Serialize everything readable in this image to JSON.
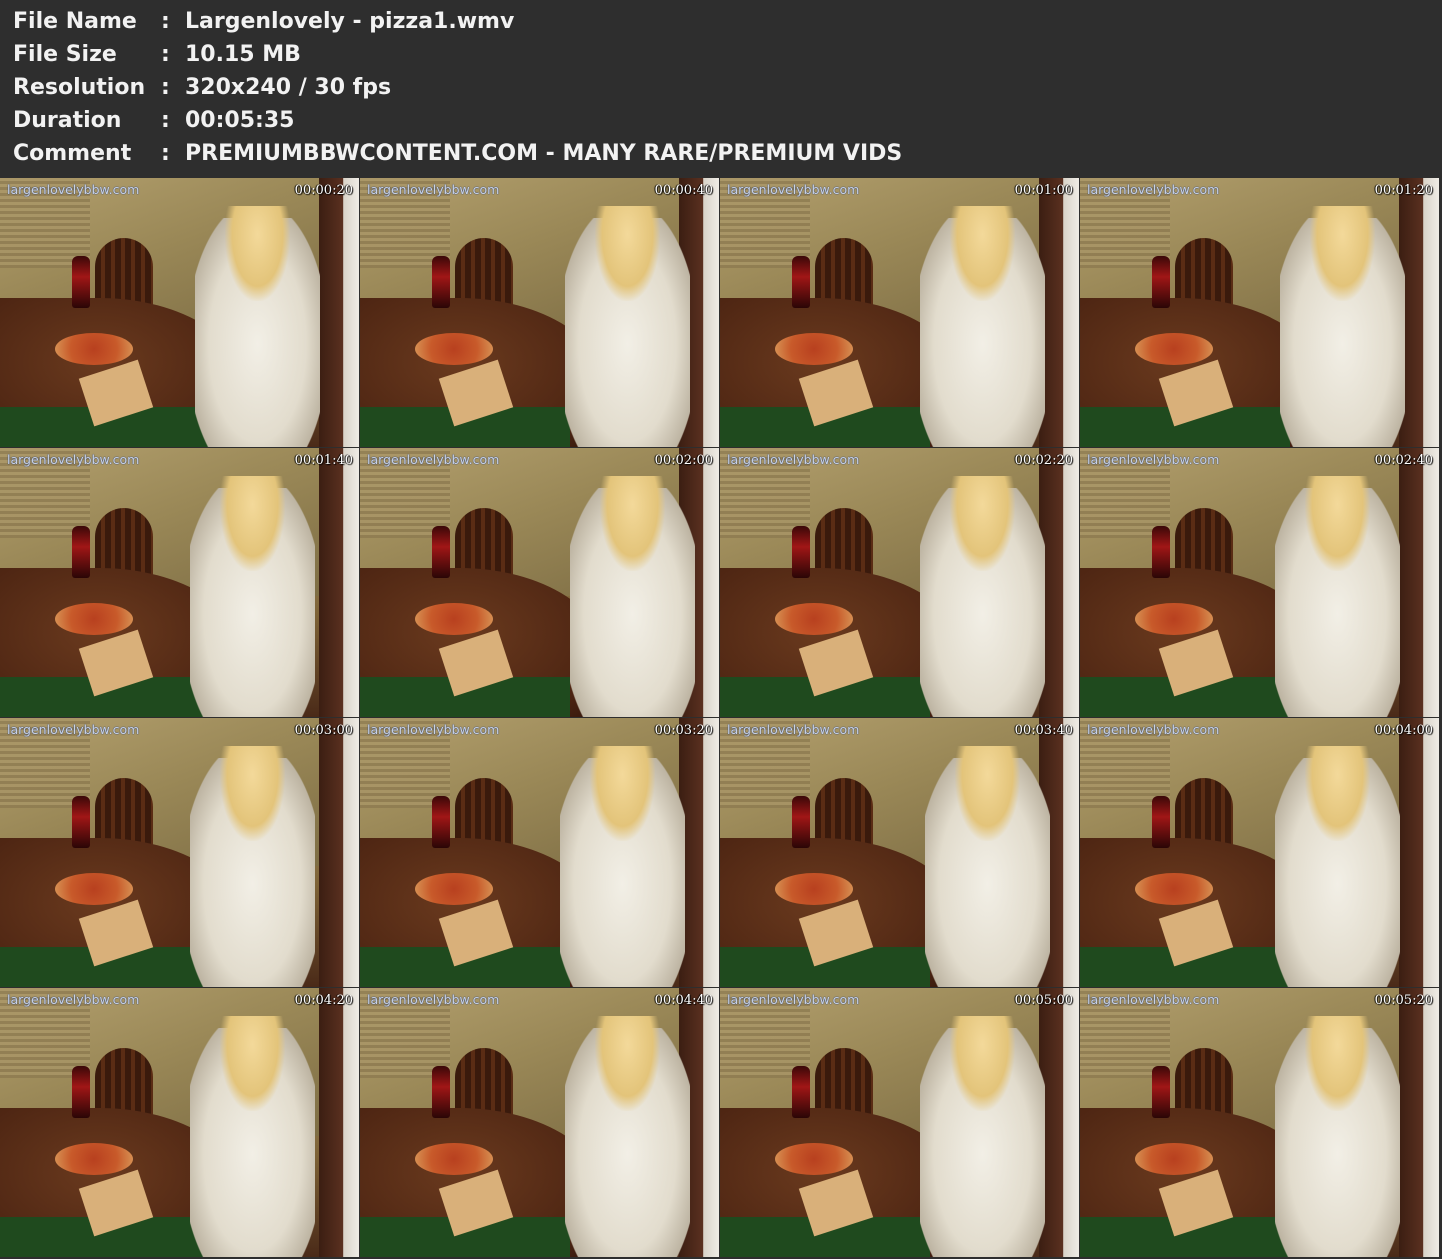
{
  "info": {
    "rows": [
      {
        "label": "File Name",
        "value": "Largenlovely - pizza1.wmv"
      },
      {
        "label": "File Size",
        "value": "10.15 MB"
      },
      {
        "label": "Resolution",
        "value": "320x240 / 30 fps"
      },
      {
        "label": "Duration",
        "value": "00:05:35"
      },
      {
        "label": "Comment",
        "value": "PREMIUMBBWCONTENT.COM - MANY RARE/PREMIUM VIDS"
      }
    ],
    "separator": ":"
  },
  "thumbnails": {
    "watermark": "largenlovelybbw.com",
    "timestamps": [
      "00:00:20",
      "00:00:40",
      "00:01:00",
      "00:01:20",
      "00:01:40",
      "00:02:00",
      "00:02:20",
      "00:02:40",
      "00:03:00",
      "00:03:20",
      "00:03:40",
      "00:04:00",
      "00:04:20",
      "00:04:40",
      "00:05:00",
      "00:05:20"
    ]
  },
  "colors": {
    "background": "#2e2e2e",
    "header_text": "#f2f2f2",
    "watermark_text": "#c9d3e6",
    "timestamp_text": "#ffffff"
  }
}
